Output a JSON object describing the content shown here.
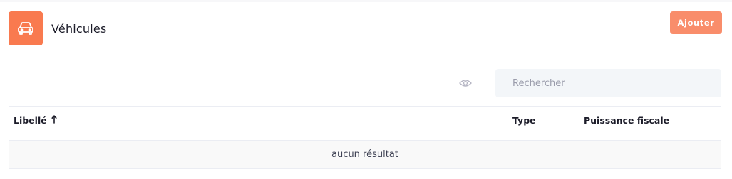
{
  "header": {
    "title": "Véhicules",
    "icon": "car-icon",
    "accent_color": "#f97a4f",
    "add_label": "Ajouter",
    "add_color": "#f98d6b"
  },
  "search": {
    "placeholder": "Rechercher",
    "value": "",
    "visibility_icon": "eye-icon"
  },
  "table": {
    "columns": [
      {
        "label": "Libellé",
        "sort": "ascending",
        "sort_icon": "arrow-up-icon"
      },
      {
        "label": "Type"
      },
      {
        "label": "Puissance fiscale"
      }
    ],
    "empty_message": "aucun résultat"
  }
}
